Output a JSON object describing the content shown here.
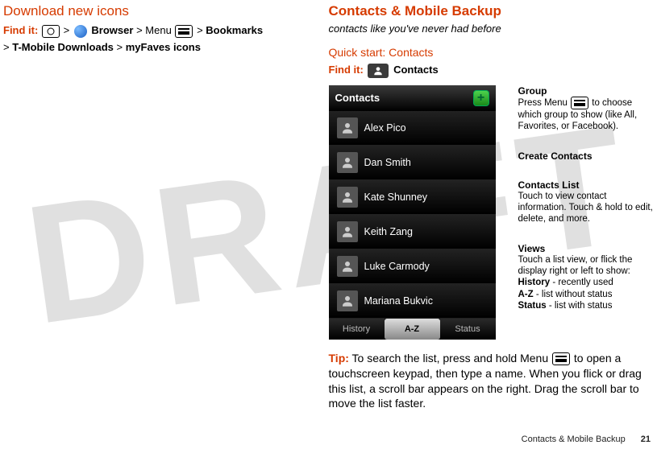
{
  "watermark": "DRAFT",
  "left": {
    "section_title": "Download new icons",
    "findit_label": "Find it:",
    "path": {
      "browser": "Browser",
      "menu": "Menu",
      "bookmarks": "Bookmarks",
      "tmobile": "T-Mobile Downloads",
      "myfaves": "myFaves icons",
      "sep": ">"
    }
  },
  "right": {
    "section_title": "Contacts & Mobile Backup",
    "subtitle": "contacts like you've never had before",
    "quickstart_heading": "Quick start: Contacts",
    "findit_label": "Find it:",
    "findit_target": "Contacts",
    "phone": {
      "header_title": "Contacts",
      "contacts": [
        "Alex Pico",
        "Dan Smith",
        "Kate Shunney",
        "Keith Zang",
        "Luke Carmody",
        "Mariana Bukvic"
      ],
      "tabs": {
        "history": "History",
        "az": "A-Z",
        "status": "Status"
      }
    },
    "callouts": {
      "group": {
        "title": "Group",
        "body_a": "Press Menu ",
        "body_b": " to choose which group to show (like All, Favorites, or Facebook)."
      },
      "create": {
        "title": "Create Contacts"
      },
      "list": {
        "title": "Contacts List",
        "body": "Touch to view contact information. Touch & hold to edit, delete, and more."
      },
      "views": {
        "title": "Views",
        "body": "Touch a list view, or flick the display right or left to show:",
        "history_lbl": "History",
        "history_txt": " - recently used",
        "az_lbl": "A-Z",
        "az_txt": " - list without status",
        "status_lbl": "Status",
        "status_txt": " - list with status"
      }
    },
    "tip": {
      "label": "Tip:",
      "text_a": " To search the list, press and hold Menu ",
      "text_b": " to open a touchscreen keypad, then type a name. When you flick or drag this list, a scroll bar appears on the right. Drag the scroll bar to move the list faster."
    }
  },
  "footer": {
    "section": "Contacts & Mobile Backup",
    "page": "21"
  }
}
